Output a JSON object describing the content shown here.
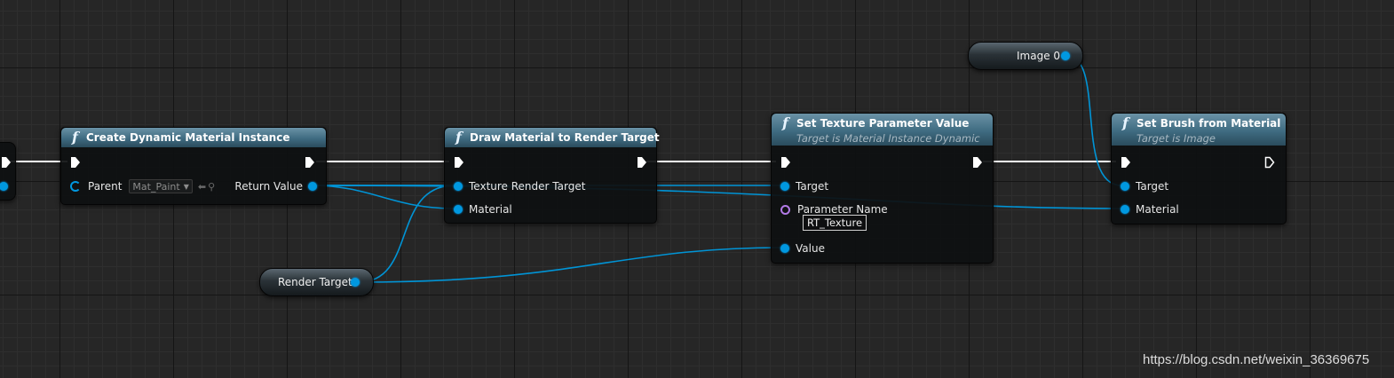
{
  "nodes": {
    "create_dynamic_material_instance": {
      "title": "Create Dynamic Material Instance",
      "pins": {
        "parent_label": "Parent",
        "parent_value": "Mat_Paint",
        "return_value": "Return Value"
      }
    },
    "draw_material_to_render_target": {
      "title": "Draw Material to Render Target",
      "pins": {
        "texture_render_target": "Texture Render Target",
        "material": "Material"
      }
    },
    "set_texture_parameter_value": {
      "title": "Set Texture Parameter Value",
      "subtitle": "Target is Material Instance Dynamic",
      "pins": {
        "target": "Target",
        "parameter_name": "Parameter Name",
        "parameter_value": "RT_Texture",
        "value": "Value"
      }
    },
    "set_brush_from_material": {
      "title": "Set Brush from Material",
      "subtitle": "Target is Image",
      "pins": {
        "target": "Target",
        "material": "Material"
      }
    }
  },
  "variables": {
    "render_target": "Render Target",
    "image_0": "Image 0"
  },
  "icons": {
    "function": "f",
    "dropdown_caret": "▼",
    "use_selected": "⬅",
    "browse": "⚲"
  },
  "colors": {
    "exec_wire": "#ffffff",
    "object_pin": "#0098e0",
    "name_pin": "#b27ae6",
    "node_header": "#3f6b81"
  },
  "watermark": "https://blog.csdn.net/weixin_36369675"
}
